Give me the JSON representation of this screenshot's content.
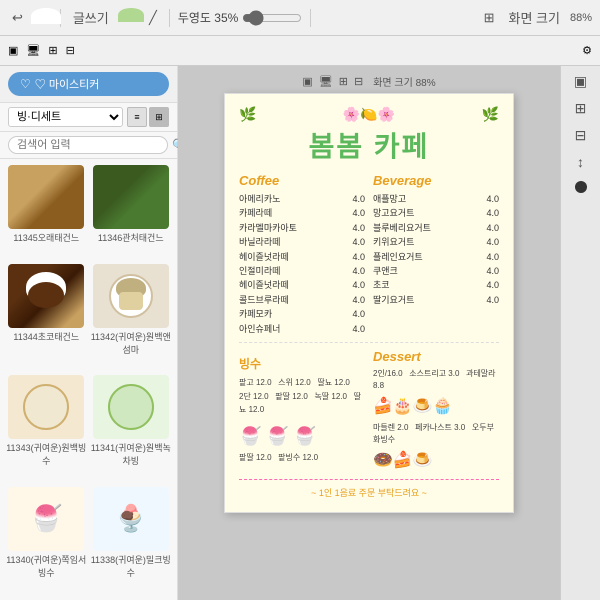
{
  "toolbar": {
    "undo_label": "↩",
    "redo_label": "↪",
    "text_label": "글쓰기",
    "shape_label": "□",
    "line_label": "—",
    "zoom_label": "두영도 35%",
    "zoom_value": "35",
    "fit_label": "화면 크기",
    "fit_pct": "88%"
  },
  "toolbar2": {
    "items": [
      "▣",
      "🖥",
      "⊞",
      "⊟"
    ]
  },
  "sidebar": {
    "my_sticker_label": "♡ 마이스티커",
    "dropdown_default": "빙·디세트",
    "search_placeholder": "검색어 입력",
    "stickers": [
      {
        "id": "s1",
        "label": "11345오래태건느",
        "color_class": "s1"
      },
      {
        "id": "s2",
        "label": "11346관처태건느",
        "color_class": "s2"
      },
      {
        "id": "s3",
        "label": "11344초코태건느",
        "color_class": "s3"
      },
      {
        "id": "s4",
        "label": "11342(귀여운)원백앤섬마",
        "color_class": "s4"
      },
      {
        "id": "s5",
        "label": "11343(귀여운)원백빙수",
        "color_class": "s5"
      },
      {
        "id": "s6",
        "label": "11341(귀여운)원백녹차빙",
        "color_class": "s6"
      },
      {
        "id": "s7",
        "label": "11340(귀여운)쪽임서빙수",
        "color_class": "s7"
      },
      {
        "id": "s8",
        "label": "11338(귀여운)밀크빙수",
        "color_class": "s8"
      }
    ]
  },
  "document": {
    "cafe_name": "봄봄 카페",
    "coffee_title": "Coffee",
    "beverage_title": "Beverage",
    "ice_title": "빙수",
    "dessert_title": "Dessert",
    "coffee_items": [
      {
        "name": "아메리카노",
        "price": "4.0"
      },
      {
        "name": "카페라떼",
        "price": "4.0"
      },
      {
        "name": "카라멜마카아토",
        "price": "4.0"
      },
      {
        "name": "바닐라라떼",
        "price": "4.0"
      },
      {
        "name": "헤이즐넛라떼",
        "price": "4.0"
      },
      {
        "name": "인절미라떼",
        "price": "4.0"
      },
      {
        "name": "헤이즐넛라떼",
        "price": "4.0"
      },
      {
        "name": "콜드브루라떼",
        "price": "4.0"
      },
      {
        "name": "카페모카",
        "price": "4.0"
      },
      {
        "name": "아인슈페너",
        "price": "4.0"
      }
    ],
    "beverage_items": [
      {
        "name": "애플망고",
        "price": "4.0"
      },
      {
        "name": "망고요거트",
        "price": "4.0"
      },
      {
        "name": "블루베리요거트",
        "price": "4.0"
      },
      {
        "name": "키위요거트",
        "price": "4.0"
      },
      {
        "name": "플레인요거트",
        "price": "4.0"
      },
      {
        "name": "쿠앤크",
        "price": "4.0"
      },
      {
        "name": "초코",
        "price": "4.0"
      },
      {
        "name": "딸기요거트",
        "price": "4.0"
      }
    ],
    "ice_rows": [
      "팥고 12.0   스위 12.0   딸뇨 12.0",
      "2단 12.0   팥딸 12.0   녹딸 12.0   딸뇨 12.0",
      "팥딸 12.0   팥빙수 12.0"
    ],
    "dessert_note": "1인 1음료 주문 부탁드려요 :)",
    "dessert_prices": "2인/16.0   소스트리고 3.0   과테말라 8.8   마들렌 2.0   페카나스트 3.0   오두부화빙수",
    "footer_note": "~ 1인 1음료 주문 부탁드려요 ~"
  }
}
